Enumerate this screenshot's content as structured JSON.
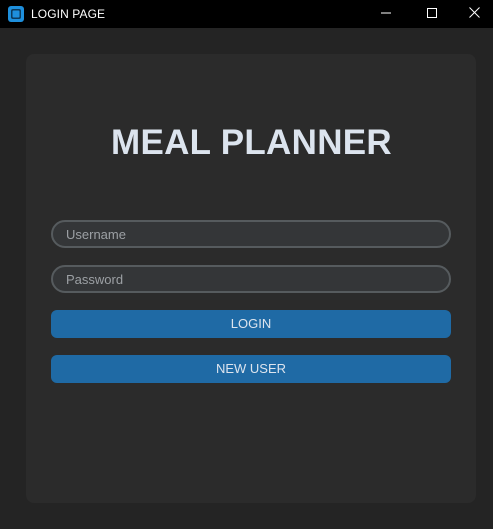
{
  "window": {
    "title": "LOGIN PAGE",
    "icons": {
      "app": "app-icon",
      "minimize": "minimize-icon",
      "maximize": "maximize-icon",
      "close": "close-icon"
    }
  },
  "main": {
    "heading": "MEAL PLANNER",
    "username": {
      "placeholder": "Username",
      "value": ""
    },
    "password": {
      "placeholder": "Password",
      "value": ""
    },
    "login_label": "LOGIN",
    "new_user_label": "NEW USER"
  },
  "colors": {
    "window_bg": "#242424",
    "frame_bg": "#2b2b2b",
    "titlebar_bg": "#000000",
    "field_bg": "#343638",
    "field_border": "#565b5e",
    "button_bg": "#1f6aa5",
    "text": "#dce4ee",
    "app_icon": "#1e8fdc"
  }
}
